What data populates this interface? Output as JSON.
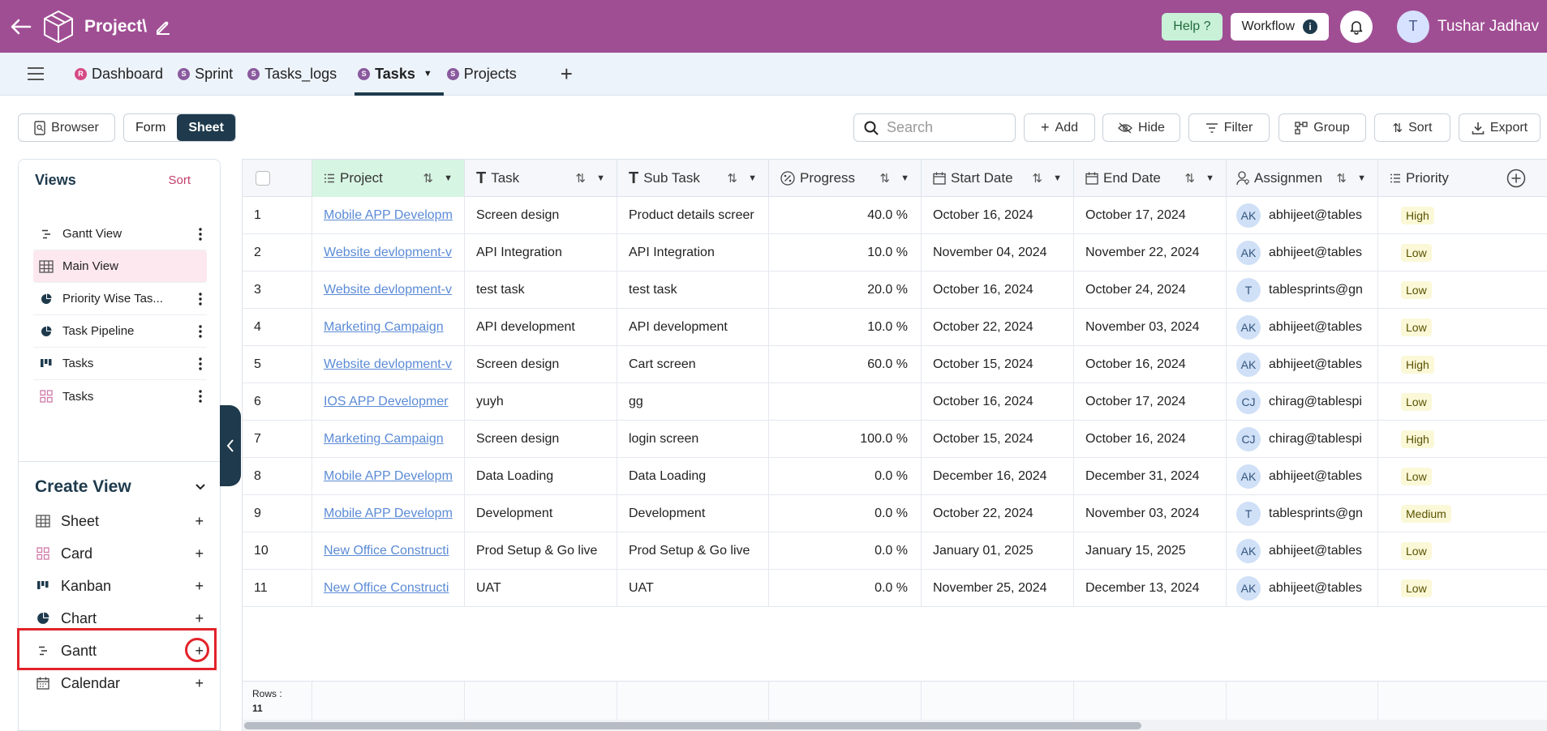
{
  "header": {
    "project_title": "Project\\",
    "help_label": "Help ?",
    "workflow_label": "Workflow",
    "user_initial": "T",
    "user_name": "Tushar Jadhav"
  },
  "tabs": [
    {
      "label": "Dashboard",
      "badge": "R"
    },
    {
      "label": "Sprint",
      "badge": "S"
    },
    {
      "label": "Tasks_logs",
      "badge": "S"
    },
    {
      "label": "Tasks",
      "badge": "S",
      "active": true
    },
    {
      "label": "Projects",
      "badge": "S"
    }
  ],
  "toolbar": {
    "browser_label": "Browser",
    "form_label": "Form",
    "sheet_label": "Sheet",
    "search_placeholder": "Search",
    "add_label": "Add",
    "hide_label": "Hide",
    "filter_label": "Filter",
    "group_label": "Group",
    "sort_label": "Sort",
    "export_label": "Export"
  },
  "views": {
    "title": "Views",
    "sort_label": "Sort",
    "items": [
      {
        "label": "Gantt View",
        "icon": "gantt-icon"
      },
      {
        "label": "Main View",
        "icon": "sheet-icon",
        "selected": true
      },
      {
        "label": "Priority Wise Tas...",
        "icon": "chart-icon"
      },
      {
        "label": "Task Pipeline",
        "icon": "chart-icon"
      },
      {
        "label": "Tasks",
        "icon": "kanban-icon"
      },
      {
        "label": "Tasks",
        "icon": "card-icon"
      }
    ]
  },
  "create_view": {
    "title": "Create View",
    "items": [
      {
        "label": "Sheet",
        "icon": "sheet-icon"
      },
      {
        "label": "Card",
        "icon": "card-icon"
      },
      {
        "label": "Kanban",
        "icon": "kanban-icon"
      },
      {
        "label": "Chart",
        "icon": "chart-icon"
      },
      {
        "label": "Gantt",
        "icon": "gantt-icon"
      },
      {
        "label": "Calendar",
        "icon": "calendar-icon"
      }
    ]
  },
  "grid": {
    "columns": [
      "Project",
      "Task",
      "Sub Task",
      "Progress",
      "Start Date",
      "End Date",
      "Assignmen",
      "Priority"
    ],
    "rows": [
      {
        "n": "1",
        "project": "Mobile APP Developm",
        "task": "Screen design",
        "subtask": "Product details screer",
        "progress": "40.0 %",
        "start": "October 16, 2024",
        "end": "October 17, 2024",
        "av": "AK",
        "assignee": "abhijeet@tables",
        "priority": "High"
      },
      {
        "n": "2",
        "project": "Website devlopment-v",
        "task": "API Integration",
        "subtask": "API Integration",
        "progress": "10.0 %",
        "start": "November 04, 2024",
        "end": "November 22, 2024",
        "av": "AK",
        "assignee": "abhijeet@tables",
        "priority": "Low"
      },
      {
        "n": "3",
        "project": "Website devlopment-v",
        "task": "test task",
        "subtask": "test task",
        "progress": "20.0 %",
        "start": "October 16, 2024",
        "end": "October 24, 2024",
        "av": "T",
        "assignee": "tablesprints@gn",
        "priority": "Low"
      },
      {
        "n": "4",
        "project": "Marketing Campaign",
        "task": "API development",
        "subtask": "API development",
        "progress": "10.0 %",
        "start": "October 22, 2024",
        "end": "November 03, 2024",
        "av": "AK",
        "assignee": "abhijeet@tables",
        "priority": "Low"
      },
      {
        "n": "5",
        "project": "Website devlopment-v",
        "task": "Screen design",
        "subtask": "Cart screen",
        "progress": "60.0 %",
        "start": "October 15, 2024",
        "end": "October 16, 2024",
        "av": "AK",
        "assignee": "abhijeet@tables",
        "priority": "High"
      },
      {
        "n": "6",
        "project": "IOS APP Developmer",
        "task": "yuyh",
        "subtask": "gg",
        "progress": "",
        "start": "October 16, 2024",
        "end": "October 17, 2024",
        "av": "CJ",
        "assignee": "chirag@tablespi",
        "priority": "Low"
      },
      {
        "n": "7",
        "project": "Marketing Campaign",
        "task": "Screen design",
        "subtask": "login screen",
        "progress": "100.0 %",
        "start": "October 15, 2024",
        "end": "October 16, 2024",
        "av": "CJ",
        "assignee": "chirag@tablespi",
        "priority": "High"
      },
      {
        "n": "8",
        "project": "Mobile APP Developm",
        "task": "Data Loading",
        "subtask": "Data Loading",
        "progress": "0.0 %",
        "start": "December 16, 2024",
        "end": "December 31, 2024",
        "av": "AK",
        "assignee": "abhijeet@tables",
        "priority": "Low"
      },
      {
        "n": "9",
        "project": "Mobile APP Developm",
        "task": "Development",
        "subtask": "Development",
        "progress": "0.0 %",
        "start": "October 22, 2024",
        "end": "November 03, 2024",
        "av": "T",
        "assignee": "tablesprints@gn",
        "priority": "Medium"
      },
      {
        "n": "10",
        "project": "New Office Constructi",
        "task": "Prod Setup & Go live",
        "subtask": "Prod Setup & Go live",
        "progress": "0.0 %",
        "start": "January 01, 2025",
        "end": "January 15, 2025",
        "av": "AK",
        "assignee": "abhijeet@tables",
        "priority": "Low"
      },
      {
        "n": "11",
        "project": "New Office Constructi",
        "task": "UAT",
        "subtask": "UAT",
        "progress": "0.0 %",
        "start": "November 25, 2024",
        "end": "December 13, 2024",
        "av": "AK",
        "assignee": "abhijeet@tables",
        "priority": "Low"
      }
    ],
    "rows_label": "Rows :",
    "rows_count": "11"
  },
  "colors": {
    "brand": "#a04e94",
    "accent": "#1e3a4c",
    "highlight": "#e2232a"
  }
}
